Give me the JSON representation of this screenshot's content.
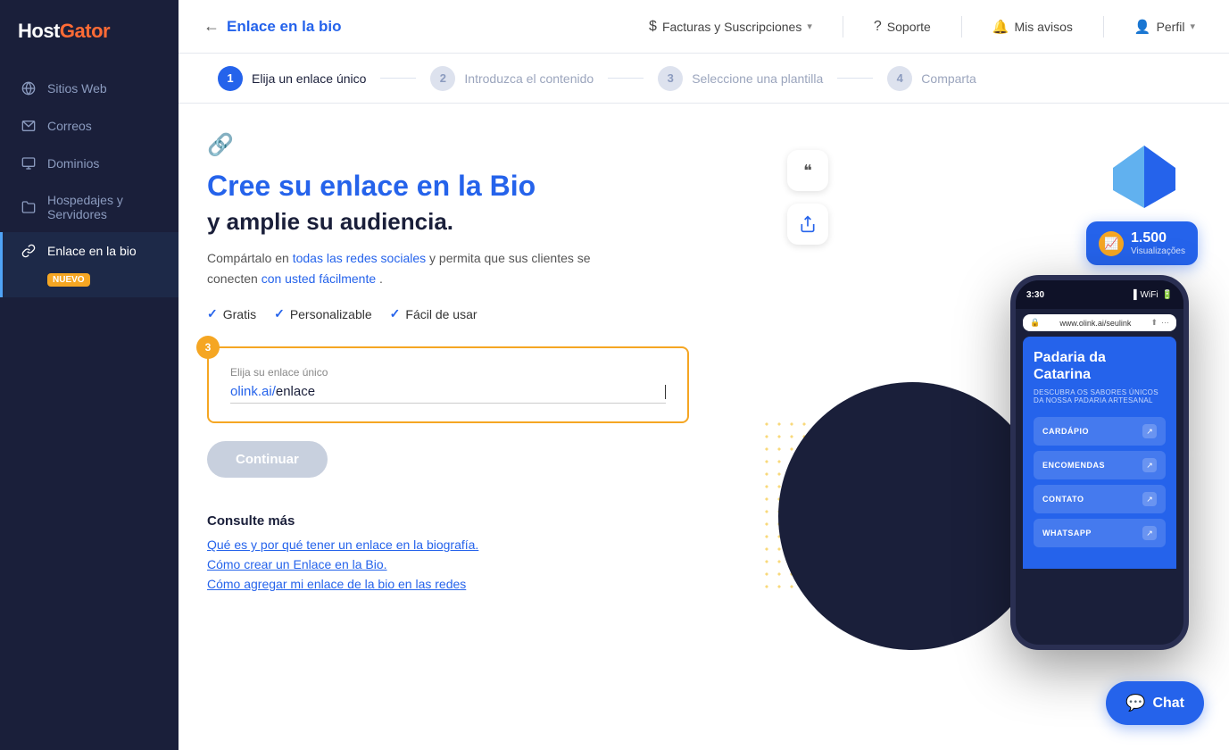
{
  "sidebar": {
    "logo": "HostGator",
    "items": [
      {
        "id": "sitios-web",
        "label": "Sitios Web",
        "icon": "globe"
      },
      {
        "id": "correos",
        "label": "Correos",
        "icon": "mail"
      },
      {
        "id": "dominios",
        "label": "Dominios",
        "icon": "domain"
      },
      {
        "id": "hospedajes",
        "label": "Hospedajes y Servidores",
        "icon": "folder"
      },
      {
        "id": "enlace-bio",
        "label": "Enlace en la bio",
        "icon": "link",
        "active": true,
        "badge": "NUEVO"
      }
    ]
  },
  "header": {
    "back_label": "Enlace en la bio",
    "billing_label": "Facturas y Suscripciones",
    "support_label": "Soporte",
    "notices_label": "Mis avisos",
    "profile_label": "Perfil"
  },
  "steps": [
    {
      "num": "1",
      "label": "Elija un enlace único",
      "active": true
    },
    {
      "num": "2",
      "label": "Introduzca el contenido",
      "active": false
    },
    {
      "num": "3",
      "label": "Seleccione una plantilla",
      "active": false
    },
    {
      "num": "4",
      "label": "Comparta",
      "active": false
    }
  ],
  "main": {
    "title": "Cree su enlace en la Bio",
    "subtitle": "y amplie su audiencia.",
    "description_part1": "Compártalo en",
    "description_link1": "todas las redes sociales",
    "description_part2": " y permita que sus clientes se conecten",
    "description_link2": "con usted fácilmente",
    "description_end": ".",
    "features": [
      {
        "label": "Gratis"
      },
      {
        "label": "Personalizable"
      },
      {
        "label": "Fácil de usar"
      }
    ],
    "input_label": "Elija su enlace único",
    "input_prefix": "olink.ai/",
    "input_placeholder": "enlace",
    "continue_btn": "Continuar",
    "consulte_title": "Consulte más",
    "links": [
      "Qué es y por qué tener un enlace en la biografía.",
      "Cómo crear un Enlace en la Bio.",
      "Cómo agregar mi enlace de la bio en las redes"
    ]
  },
  "phone": {
    "time": "3:30",
    "url": "www.olink.ai/seulink",
    "brand_title": "Padaria da Catarina",
    "brand_sub": "DESCUBRA OS SABORES ÚNICOS DA NOSSA PADARIA ARTESANAL",
    "menu_items": [
      {
        "label": "CARDÁPIO"
      },
      {
        "label": "ENCOMENDAS"
      },
      {
        "label": "CONTATO"
      },
      {
        "label": "WHATSAPP"
      }
    ]
  },
  "views_badge": {
    "number": "1.500",
    "label": "Visualizações"
  },
  "chat": {
    "label": "Chat"
  }
}
